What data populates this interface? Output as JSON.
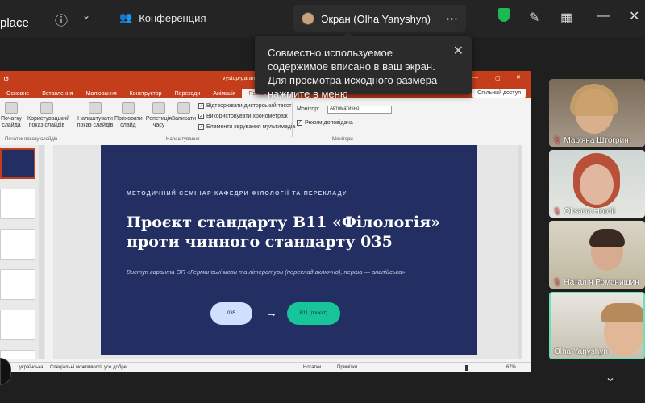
{
  "topbar": {
    "brand": "place",
    "meeting_title": "Конференция",
    "share_label": "Экран (Olha Yanyshyn)"
  },
  "tooltip": {
    "text": "Совместно используемое содержимое вписано в ваш экран. Для просмотра исходного размера нажмите в меню"
  },
  "ppt": {
    "window_title": "vystup-garanta-metodsy",
    "tabs": [
      "Основне",
      "Вставлення",
      "Малювання",
      "Конструктор",
      "Переходи",
      "Анімація",
      "Показ слайдів"
    ],
    "active_tab": "Показ слайдів",
    "share_btn": "Спільний доступ",
    "ribbon": {
      "b1": "Початку слайда",
      "b2": "Користувацький показ слайдів",
      "b3": "Налаштувати показ слайдів",
      "b4": "Приховати слайд",
      "b5": "Репетиція часу",
      "b6": "Записати",
      "chk1": "Відтворювати дикторський текст",
      "chk2": "Використовувати хронометраж",
      "chk3": "Елементи керування мультимедіа",
      "monitor_label": "Монітор:",
      "monitor_value": "Автоматично",
      "presenter": "Режим доповідача",
      "grp1": "Початок показу слайдів",
      "grp2": "Налаштування",
      "grp3": "Монітори"
    },
    "slide": {
      "kicker": "МЕТОДИЧНИЙ СЕМІНАР КАФЕДРИ ФІЛОЛОГІЇ ТА ПЕРЕКЛАДУ",
      "title": "Проєкт стандарту B11 «Філологія» проти чинного стандарту 035",
      "subtitle": "Виступ гаранта ОП «Германські мови та літератури (переклад включно), перша — англійська»",
      "pill_left": "035",
      "arrow": "→",
      "pill_right": "B11 (проєкт)"
    },
    "status": {
      "lang": "українська",
      "accessibility": "Спеціальні можливості: усе добре",
      "notes": "Нотатки",
      "comments": "Примітки",
      "zoom": "67%"
    }
  },
  "participants": [
    {
      "name": "Мар'яна Штогрин"
    },
    {
      "name": "Oksana Hordii"
    },
    {
      "name": "Наталія Романишин"
    },
    {
      "name": "Olha Yanyshyn"
    }
  ],
  "colors": {
    "ppt_accent": "#c43e1c",
    "slide_bg": "#232f63",
    "active_speaker": "#6ee0b8"
  }
}
